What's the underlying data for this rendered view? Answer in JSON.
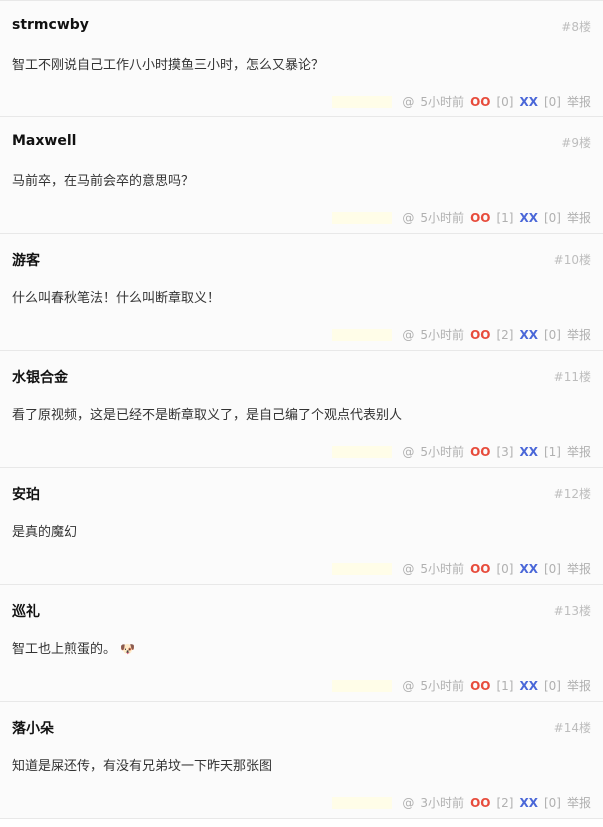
{
  "meta_labels": {
    "at": "@",
    "oo_label": "OO",
    "xx_label": "XX",
    "report": "举报"
  },
  "comments": [
    {
      "author": "strmcwby",
      "floor": "#8楼",
      "text": "智工不刚说自己工作八小时摸鱼三小时，怎么又暴论？",
      "emoji": "",
      "time": "5小时前",
      "oo": "[0]",
      "xx": "[0]"
    },
    {
      "author": "Maxwell",
      "floor": "#9楼",
      "text": "马前卒，在马前会卒的意思吗？",
      "emoji": "",
      "time": "5小时前",
      "oo": "[1]",
      "xx": "[0]"
    },
    {
      "author": "游客",
      "floor": "#10楼",
      "text": "什么叫春秋笔法！什么叫断章取义！",
      "emoji": "",
      "time": "5小时前",
      "oo": "[2]",
      "xx": "[0]"
    },
    {
      "author": "水银合金",
      "floor": "#11楼",
      "text": "看了原视频，这是已经不是断章取义了，是自己编了个观点代表别人",
      "emoji": "",
      "time": "5小时前",
      "oo": "[3]",
      "xx": "[1]"
    },
    {
      "author": "安珀",
      "floor": "#12楼",
      "text": "是真的魔幻",
      "emoji": "",
      "time": "5小时前",
      "oo": "[0]",
      "xx": "[0]"
    },
    {
      "author": "巡礼",
      "floor": "#13楼",
      "text": "智工也上煎蛋的。",
      "emoji": "🐶",
      "time": "5小时前",
      "oo": "[1]",
      "xx": "[0]"
    },
    {
      "author": "落小朵",
      "floor": "#14楼",
      "text": "知道是屎还传，有没有兄弟坟一下昨天那张图",
      "emoji": "",
      "time": "3小时前",
      "oo": "[2]",
      "xx": "[0]"
    }
  ]
}
